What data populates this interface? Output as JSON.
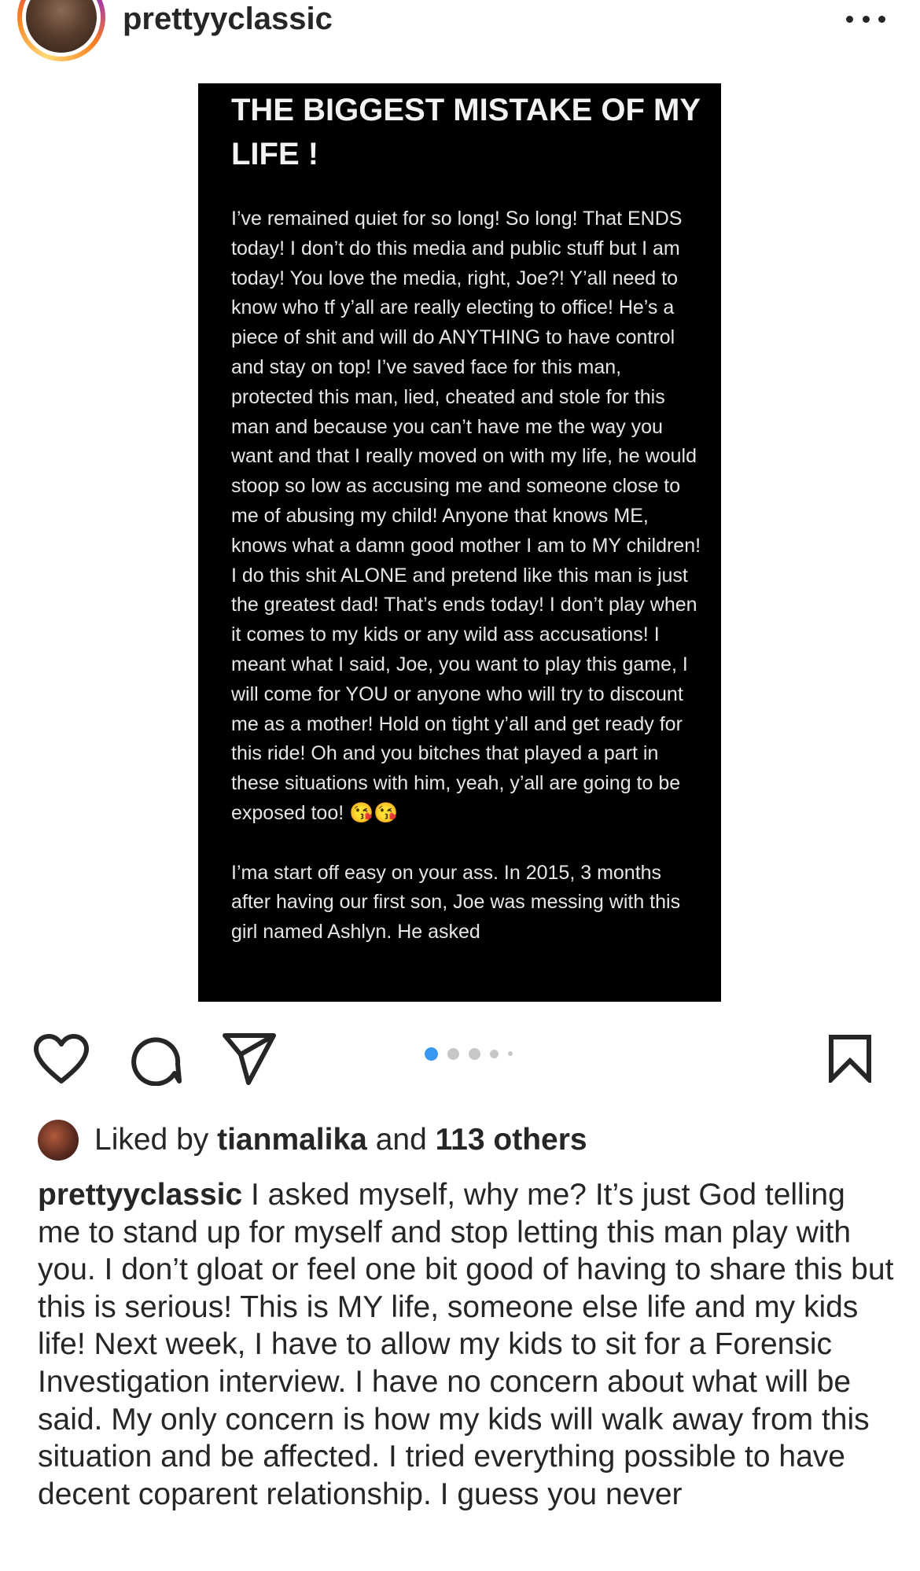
{
  "header": {
    "username": "prettyyclassic"
  },
  "post": {
    "title": "THE BIGGEST MISTAKE OF MY LIFE !",
    "body_paragraphs": [
      "I’ve remained quiet for so long! So long! That ENDS today! I don’t do this media and public stuff but I am today! You love the media, right, Joe?! Y’all need to know who tf y’all are really electing to office! He’s a piece of shit and will do ANYTHING to have control and stay on top! I’ve saved face for this man, protected this man, lied, cheated and stole for this man and because you can’t have me the way you want and that I really moved on with my life, he would stoop so low as accusing me and someone close to me of abusing my child! Anyone that knows ME, knows what a damn good mother I am to MY children! I do this shit ALONE and pretend like this man is just the greatest dad! That’s ends today! I don’t play when it comes to my kids or any wild ass accusations! I meant what I said, Joe, you want to play this game, I will come for YOU or anyone who will try to discount me as a mother! Hold on tight y’all and get ready for this ride! Oh and you bitches that played a part in these situations with him, yeah, y’all are going to be exposed too! 😘😘",
      "I’ma start off easy on your ass. In 2015, 3 months after having our first son, Joe was messing with this girl named Ashlyn. He asked"
    ]
  },
  "carousel": {
    "current": 1,
    "total": 5
  },
  "likes": {
    "prefix": "Liked by ",
    "user": "tianmalika",
    "middle": " and ",
    "others": "113 others"
  },
  "caption": {
    "username": "prettyyclassic",
    "text": " I asked myself, why me? It’s just God telling me to stand up for myself and stop letting this man play with you. I don’t gloat or feel one bit good of having to share this but this is serious! This is MY life, someone else life and my kids life! Next week, I have to allow my kids to sit for a Forensic Investigation interview. I have no concern about what will be said. My only concern is how my kids will walk away from this situation and be affected. I tried everything possible to have decent coparent relationship. I guess you never"
  },
  "icons": {
    "like": "heart-icon",
    "comment": "comment-icon",
    "share": "send-icon",
    "save": "bookmark-icon",
    "more": "more-icon"
  },
  "colors": {
    "carousel_active": "#3897f0",
    "carousel_inactive": "#c7c7c7",
    "text": "#262626",
    "post_background": "#000000"
  }
}
